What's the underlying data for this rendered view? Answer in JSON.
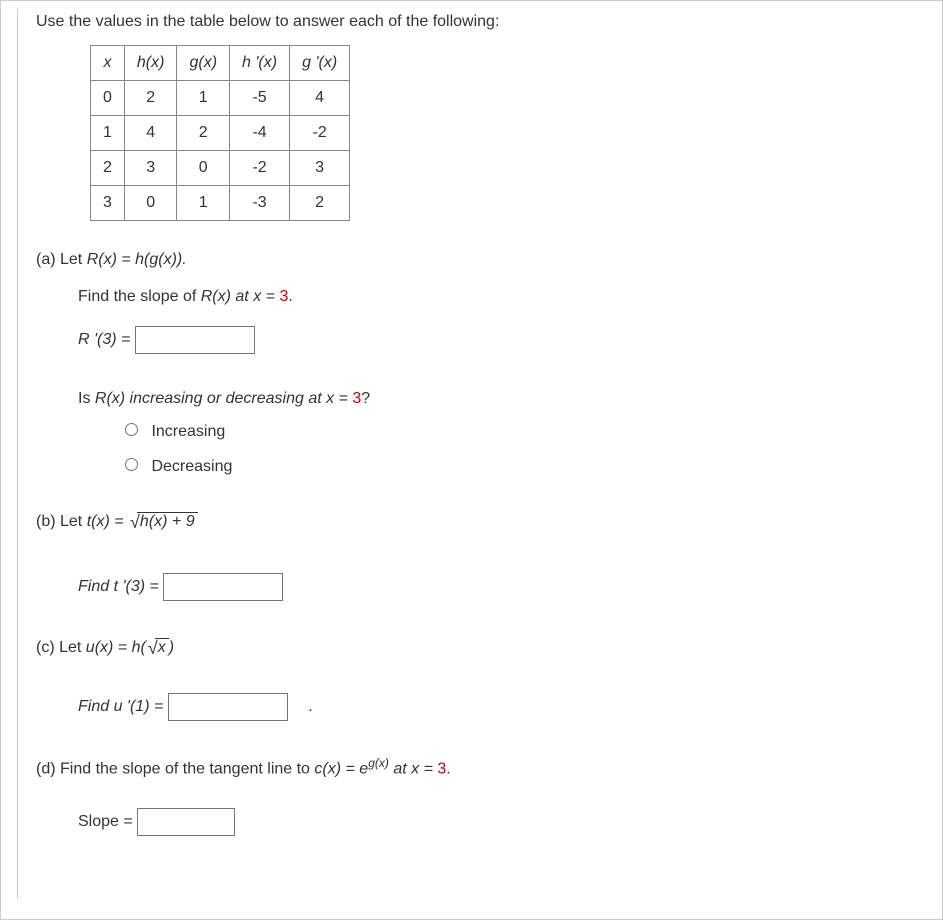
{
  "intro": "Use the values in the table below to answer each of the following:",
  "table": {
    "headers": [
      "x",
      "h(x)",
      "g(x)",
      "h '(x)",
      "g '(x)"
    ],
    "rows": [
      [
        "0",
        "2",
        "1",
        "-5",
        "4"
      ],
      [
        "1",
        "4",
        "2",
        "-4",
        "-2"
      ],
      [
        "2",
        "3",
        "0",
        "-2",
        "3"
      ],
      [
        "3",
        "0",
        "1",
        "-3",
        "2"
      ]
    ]
  },
  "parts": {
    "a": {
      "label": "(a) Let ",
      "rdef": "R(x) = h(g(x)).",
      "find_slope_pre": "Find the slope of ",
      "find_slope_mid": "R(x) at x = ",
      "find_slope_val": "3",
      "find_slope_post": ".",
      "rprime_label": "R '(3) = ",
      "incdec_pre": "Is ",
      "incdec_mid": "R(x) increasing or decreasing at x = ",
      "incdec_val": "3",
      "incdec_post": "?",
      "opt_increasing": "Increasing",
      "opt_decreasing": "Decreasing"
    },
    "b": {
      "label": "(b) Let  ",
      "tdef_pre": "t(x) = ",
      "radicand": "h(x) + 9",
      "find_label": "Find t '(3) = "
    },
    "c": {
      "label": "(c) Let  ",
      "udef_pre": "u(x) = h(",
      "radicand": "x",
      "udef_post": ")",
      "find_label": "Find u '(1) = ",
      "trailing": "."
    },
    "d": {
      "label": "(d) Find the slope of the tangent line to  ",
      "cdef_pre": "c(x) = e",
      "cdef_sup": "g(x)",
      "at_pre": "  at x = ",
      "at_val": "3",
      "at_post": ".",
      "slope_label": "Slope = "
    }
  }
}
